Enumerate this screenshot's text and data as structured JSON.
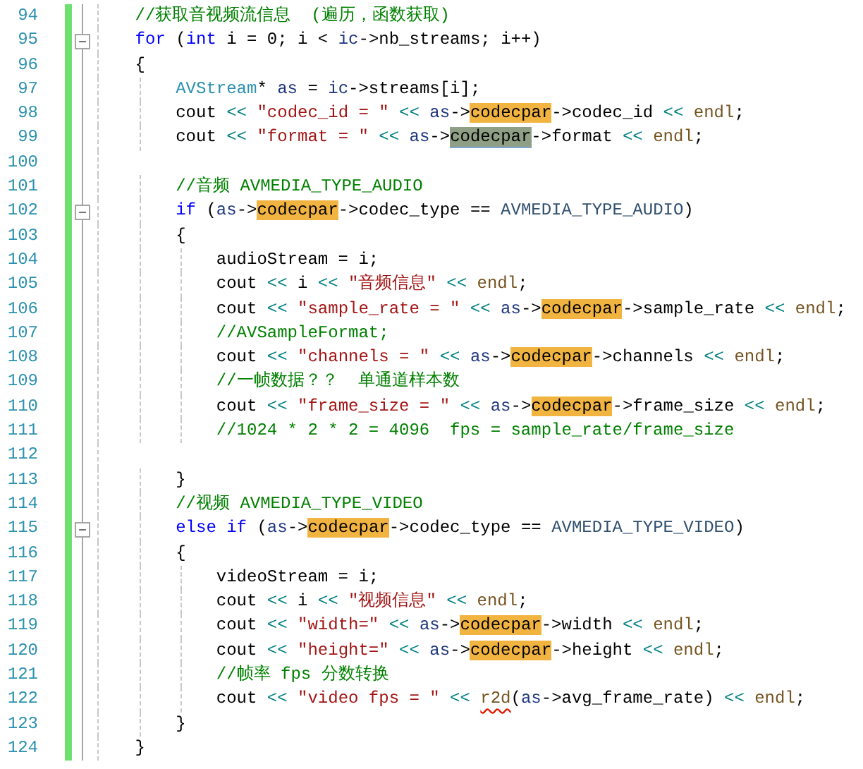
{
  "editor": {
    "lines": [
      {
        "number": "94",
        "tokens": [
          {
            "kind": "comment",
            "text": "//获取音视频流信息  (遍历，函数获取)"
          }
        ]
      },
      {
        "number": "95",
        "expanded": true,
        "tokens": [
          {
            "kind": "keyword",
            "text": "for"
          },
          {
            "kind": "plain",
            "text": " ("
          },
          {
            "kind": "keyword",
            "text": "int"
          },
          {
            "kind": "plain",
            "text": " i = 0; i < "
          },
          {
            "kind": "variable",
            "text": "ic"
          },
          {
            "kind": "plain",
            "text": "->nb_streams; i++)"
          }
        ]
      },
      {
        "number": "96",
        "tokens": [
          {
            "kind": "plain",
            "text": "{"
          }
        ]
      },
      {
        "number": "97",
        "tokens": [
          {
            "kind": "type",
            "text": "    AVStream"
          },
          {
            "kind": "plain",
            "text": "* "
          },
          {
            "kind": "variable",
            "text": "as"
          },
          {
            "kind": "plain",
            "text": " = "
          },
          {
            "kind": "variable",
            "text": "ic"
          },
          {
            "kind": "plain",
            "text": "->streams[i];"
          }
        ]
      },
      {
        "number": "98",
        "tokens": [
          {
            "kind": "plain",
            "text": "    cout"
          },
          {
            "kind": "operator",
            "text": " << "
          },
          {
            "kind": "string",
            "text": "\"codec_id = \""
          },
          {
            "kind": "operator",
            "text": " << "
          },
          {
            "kind": "variable",
            "text": "as"
          },
          {
            "kind": "plain",
            "text": "->"
          },
          {
            "kind": "match",
            "text": "codecpar"
          },
          {
            "kind": "plain",
            "text": "->codec_id"
          },
          {
            "kind": "operator",
            "text": " << "
          },
          {
            "kind": "function",
            "text": "endl"
          },
          {
            "kind": "plain",
            "text": ";"
          }
        ]
      },
      {
        "number": "99",
        "tokens": [
          {
            "kind": "plain",
            "text": "    cout"
          },
          {
            "kind": "operator",
            "text": " << "
          },
          {
            "kind": "string",
            "text": "\"format = \""
          },
          {
            "kind": "operator",
            "text": " << "
          },
          {
            "kind": "variable",
            "text": "as"
          },
          {
            "kind": "plain",
            "text": "->"
          },
          {
            "kind": "current",
            "text": "codecpar"
          },
          {
            "kind": "plain",
            "text": "->format"
          },
          {
            "kind": "operator",
            "text": " << "
          },
          {
            "kind": "function",
            "text": "endl"
          },
          {
            "kind": "plain",
            "text": ";"
          }
        ]
      },
      {
        "number": "100"
      },
      {
        "number": "101",
        "tokens": [
          {
            "kind": "comment",
            "text": "    //音频 AVMEDIA_TYPE_AUDIO"
          }
        ]
      },
      {
        "number": "102",
        "expanded": true,
        "tokens": [
          {
            "kind": "keyword",
            "text": "    if"
          },
          {
            "kind": "plain",
            "text": " ("
          },
          {
            "kind": "variable",
            "text": "as"
          },
          {
            "kind": "plain",
            "text": "->"
          },
          {
            "kind": "match",
            "text": "codecpar"
          },
          {
            "kind": "plain",
            "text": "->codec_type == "
          },
          {
            "kind": "enum",
            "text": "AVMEDIA_TYPE_AUDIO"
          },
          {
            "kind": "plain",
            "text": ")"
          }
        ]
      },
      {
        "number": "103",
        "tokens": [
          {
            "kind": "plain",
            "text": "    {"
          }
        ]
      },
      {
        "number": "104",
        "tokens": [
          {
            "kind": "plain",
            "text": "        audioStream = i;"
          }
        ]
      },
      {
        "number": "105",
        "tokens": [
          {
            "kind": "plain",
            "text": "        cout"
          },
          {
            "kind": "operator",
            "text": " << "
          },
          {
            "kind": "plain",
            "text": "i"
          },
          {
            "kind": "operator",
            "text": " << "
          },
          {
            "kind": "string",
            "text": "\"音频信息\""
          },
          {
            "kind": "operator",
            "text": " << "
          },
          {
            "kind": "function",
            "text": "endl"
          },
          {
            "kind": "plain",
            "text": ";"
          }
        ]
      },
      {
        "number": "106",
        "tokens": [
          {
            "kind": "plain",
            "text": "        cout"
          },
          {
            "kind": "operator",
            "text": " << "
          },
          {
            "kind": "string",
            "text": "\"sample_rate = \""
          },
          {
            "kind": "operator",
            "text": " << "
          },
          {
            "kind": "variable",
            "text": "as"
          },
          {
            "kind": "plain",
            "text": "->"
          },
          {
            "kind": "match",
            "text": "codecpar"
          },
          {
            "kind": "plain",
            "text": "->sample_rate"
          },
          {
            "kind": "operator",
            "text": " << "
          },
          {
            "kind": "function",
            "text": "endl"
          },
          {
            "kind": "plain",
            "text": ";"
          }
        ]
      },
      {
        "number": "107",
        "tokens": [
          {
            "kind": "comment",
            "text": "        //AVSampleFormat;"
          }
        ]
      },
      {
        "number": "108",
        "tokens": [
          {
            "kind": "plain",
            "text": "        cout"
          },
          {
            "kind": "operator",
            "text": " << "
          },
          {
            "kind": "string",
            "text": "\"channels = \""
          },
          {
            "kind": "operator",
            "text": " << "
          },
          {
            "kind": "variable",
            "text": "as"
          },
          {
            "kind": "plain",
            "text": "->"
          },
          {
            "kind": "match",
            "text": "codecpar"
          },
          {
            "kind": "plain",
            "text": "->channels"
          },
          {
            "kind": "operator",
            "text": " << "
          },
          {
            "kind": "function",
            "text": "endl"
          },
          {
            "kind": "plain",
            "text": ";"
          }
        ]
      },
      {
        "number": "109",
        "tokens": [
          {
            "kind": "comment",
            "text": "        //一帧数据？？  单通道样本数"
          }
        ]
      },
      {
        "number": "110",
        "tokens": [
          {
            "kind": "plain",
            "text": "        cout"
          },
          {
            "kind": "operator",
            "text": " << "
          },
          {
            "kind": "string",
            "text": "\"frame_size = \""
          },
          {
            "kind": "operator",
            "text": " << "
          },
          {
            "kind": "variable",
            "text": "as"
          },
          {
            "kind": "plain",
            "text": "->"
          },
          {
            "kind": "match",
            "text": "codecpar"
          },
          {
            "kind": "plain",
            "text": "->frame_size"
          },
          {
            "kind": "operator",
            "text": " << "
          },
          {
            "kind": "function",
            "text": "endl"
          },
          {
            "kind": "plain",
            "text": ";"
          }
        ]
      },
      {
        "number": "111",
        "tokens": [
          {
            "kind": "comment",
            "text": "        //1024 * 2 * 2 = 4096  fps = sample_rate/frame_size"
          }
        ]
      },
      {
        "number": "112"
      },
      {
        "number": "113",
        "tokens": [
          {
            "kind": "plain",
            "text": "    }"
          }
        ]
      },
      {
        "number": "114",
        "tokens": [
          {
            "kind": "comment",
            "text": "    //视频 AVMEDIA_TYPE_VIDEO"
          }
        ]
      },
      {
        "number": "115",
        "expanded": true,
        "tokens": [
          {
            "kind": "keyword",
            "text": "    else if"
          },
          {
            "kind": "plain",
            "text": " ("
          },
          {
            "kind": "variable",
            "text": "as"
          },
          {
            "kind": "plain",
            "text": "->"
          },
          {
            "kind": "match",
            "text": "codecpar"
          },
          {
            "kind": "plain",
            "text": "->codec_type == "
          },
          {
            "kind": "enum",
            "text": "AVMEDIA_TYPE_VIDEO"
          },
          {
            "kind": "plain",
            "text": ")"
          }
        ]
      },
      {
        "number": "116",
        "tokens": [
          {
            "kind": "plain",
            "text": "    {"
          }
        ]
      },
      {
        "number": "117",
        "tokens": [
          {
            "kind": "plain",
            "text": "        videoStream = i;"
          }
        ]
      },
      {
        "number": "118",
        "tokens": [
          {
            "kind": "plain",
            "text": "        cout"
          },
          {
            "kind": "operator",
            "text": " << "
          },
          {
            "kind": "plain",
            "text": "i"
          },
          {
            "kind": "operator",
            "text": " << "
          },
          {
            "kind": "string",
            "text": "\"视频信息\""
          },
          {
            "kind": "operator",
            "text": " << "
          },
          {
            "kind": "function",
            "text": "endl"
          },
          {
            "kind": "plain",
            "text": ";"
          }
        ]
      },
      {
        "number": "119",
        "tokens": [
          {
            "kind": "plain",
            "text": "        cout"
          },
          {
            "kind": "operator",
            "text": " << "
          },
          {
            "kind": "string",
            "text": "\"width=\""
          },
          {
            "kind": "operator",
            "text": " << "
          },
          {
            "kind": "variable",
            "text": "as"
          },
          {
            "kind": "plain",
            "text": "->"
          },
          {
            "kind": "match",
            "text": "codecpar"
          },
          {
            "kind": "plain",
            "text": "->width"
          },
          {
            "kind": "operator",
            "text": " << "
          },
          {
            "kind": "function",
            "text": "endl"
          },
          {
            "kind": "plain",
            "text": ";"
          }
        ]
      },
      {
        "number": "120",
        "tokens": [
          {
            "kind": "plain",
            "text": "        cout"
          },
          {
            "kind": "operator",
            "text": " << "
          },
          {
            "kind": "string",
            "text": "\"height=\""
          },
          {
            "kind": "operator",
            "text": " << "
          },
          {
            "kind": "variable",
            "text": "as"
          },
          {
            "kind": "plain",
            "text": "->"
          },
          {
            "kind": "match",
            "text": "codecpar"
          },
          {
            "kind": "plain",
            "text": "->height"
          },
          {
            "kind": "operator",
            "text": " << "
          },
          {
            "kind": "function",
            "text": "endl"
          },
          {
            "kind": "plain",
            "text": ";"
          }
        ]
      },
      {
        "number": "121",
        "tokens": [
          {
            "kind": "comment",
            "text": "        //帧率 fps 分数转换"
          }
        ]
      },
      {
        "number": "122",
        "tokens": [
          {
            "kind": "plain",
            "text": "        cout"
          },
          {
            "kind": "operator",
            "text": " << "
          },
          {
            "kind": "string",
            "text": "\"video fps = \""
          },
          {
            "kind": "operator",
            "text": " << "
          },
          {
            "kind": "error",
            "text": "r2d"
          },
          {
            "kind": "plain",
            "text": "("
          },
          {
            "kind": "variable",
            "text": "as"
          },
          {
            "kind": "plain",
            "text": "->avg_frame_rate)"
          },
          {
            "kind": "operator",
            "text": " << "
          },
          {
            "kind": "function",
            "text": "endl"
          },
          {
            "kind": "plain",
            "text": ";"
          }
        ]
      },
      {
        "number": "123",
        "tokens": [
          {
            "kind": "plain",
            "text": "    }"
          }
        ]
      },
      {
        "number": "124",
        "tokens": [
          {
            "kind": "plain",
            "text": "}"
          }
        ]
      }
    ]
  }
}
